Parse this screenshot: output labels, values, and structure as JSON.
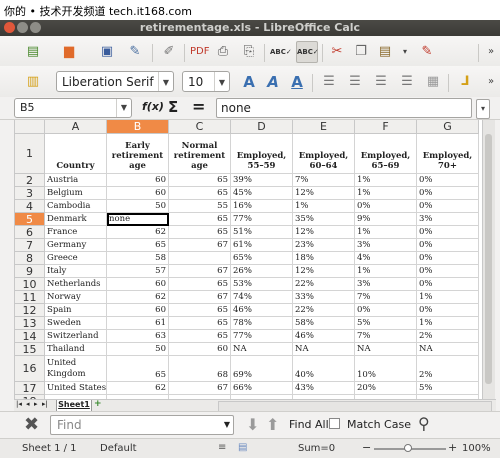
{
  "watermark": "你的 • 技术开发频道 tech.it168.com",
  "window": {
    "title": "retirementage.xls - LibreOffice Calc"
  },
  "toolbar": {
    "font_name": "Liberation Serif",
    "font_size": "10",
    "icons": [
      "new-icon",
      "open-icon",
      "save-icon",
      "edit-icon",
      "export-pdf-icon",
      "print-icon",
      "print-preview-icon",
      "spellcheck-icon",
      "autospell-icon",
      "cut-icon",
      "copy-icon",
      "paste-icon",
      "clone-format-icon",
      "styles-icon",
      "bold-icon",
      "italic-icon",
      "underline-icon",
      "align-left-icon",
      "align-center-icon",
      "align-right-icon",
      "justify-icon",
      "merge-icon",
      "currency-icon"
    ]
  },
  "formula_bar": {
    "cell_ref": "B5",
    "fx": "f(x)",
    "sigma": "Σ",
    "equals": "=",
    "content": "none"
  },
  "columns": [
    "A",
    "B",
    "C",
    "D",
    "E",
    "F",
    "G"
  ],
  "headers": [
    "Country",
    "Early retirement age",
    "Normal retirement age",
    "Employed, 55–59",
    "Employed, 60–64",
    "Employed, 65–69",
    "Employed, 70+"
  ],
  "rows": [
    {
      "num": "2",
      "cells": [
        "Austria",
        "60",
        "65",
        "39%",
        "7%",
        "1%",
        "0%"
      ]
    },
    {
      "num": "3",
      "cells": [
        "Belgium",
        "60",
        "65",
        "45%",
        "12%",
        "1%",
        "0%"
      ]
    },
    {
      "num": "4",
      "cells": [
        "Cambodia",
        "50",
        "55",
        "16%",
        "1%",
        "0%",
        "0%"
      ]
    },
    {
      "num": "5",
      "cells": [
        "Denmark",
        "none",
        "65",
        "77%",
        "35%",
        "9%",
        "3%"
      ]
    },
    {
      "num": "6",
      "cells": [
        "France",
        "62",
        "65",
        "51%",
        "12%",
        "1%",
        "0%"
      ]
    },
    {
      "num": "7",
      "cells": [
        "Germany",
        "65",
        "67",
        "61%",
        "23%",
        "3%",
        "0%"
      ]
    },
    {
      "num": "8",
      "cells": [
        "Greece",
        "58",
        "",
        "65%",
        "18%",
        "4%",
        "0%"
      ]
    },
    {
      "num": "9",
      "cells": [
        "Italy",
        "57",
        "67",
        "26%",
        "12%",
        "1%",
        "0%"
      ]
    },
    {
      "num": "10",
      "cells": [
        "Netherlands",
        "60",
        "65",
        "53%",
        "22%",
        "3%",
        "0%"
      ]
    },
    {
      "num": "11",
      "cells": [
        "Norway",
        "62",
        "67",
        "74%",
        "33%",
        "7%",
        "1%"
      ]
    },
    {
      "num": "12",
      "cells": [
        "Spain",
        "60",
        "65",
        "46%",
        "22%",
        "0%",
        "0%"
      ]
    },
    {
      "num": "13",
      "cells": [
        "Sweden",
        "61",
        "65",
        "78%",
        "58%",
        "5%",
        "1%"
      ]
    },
    {
      "num": "14",
      "cells": [
        "Switzerland",
        "63",
        "65",
        "77%",
        "46%",
        "7%",
        "2%"
      ]
    },
    {
      "num": "15",
      "cells": [
        "Thailand",
        "50",
        "60",
        "NA",
        "NA",
        "NA",
        "NA"
      ]
    },
    {
      "num": "16",
      "cells": [
        "United Kingdom",
        "65",
        "68",
        "69%",
        "40%",
        "10%",
        "2%"
      ]
    },
    {
      "num": "17",
      "cells": [
        "United States",
        "62",
        "67",
        "66%",
        "43%",
        "20%",
        "5%"
      ]
    },
    {
      "num": "18",
      "cells": [
        "",
        "",
        "",
        "",
        "",
        "",
        ""
      ]
    }
  ],
  "header_row_num": "1",
  "sheet_tab": "Sheet1",
  "find_bar": {
    "placeholder": "Find",
    "find_all": "Find All",
    "match_case": "Match Case"
  },
  "status": {
    "sheet": "Sheet 1 / 1",
    "style": "Default",
    "sum": "Sum=0",
    "zoom": "100%"
  }
}
